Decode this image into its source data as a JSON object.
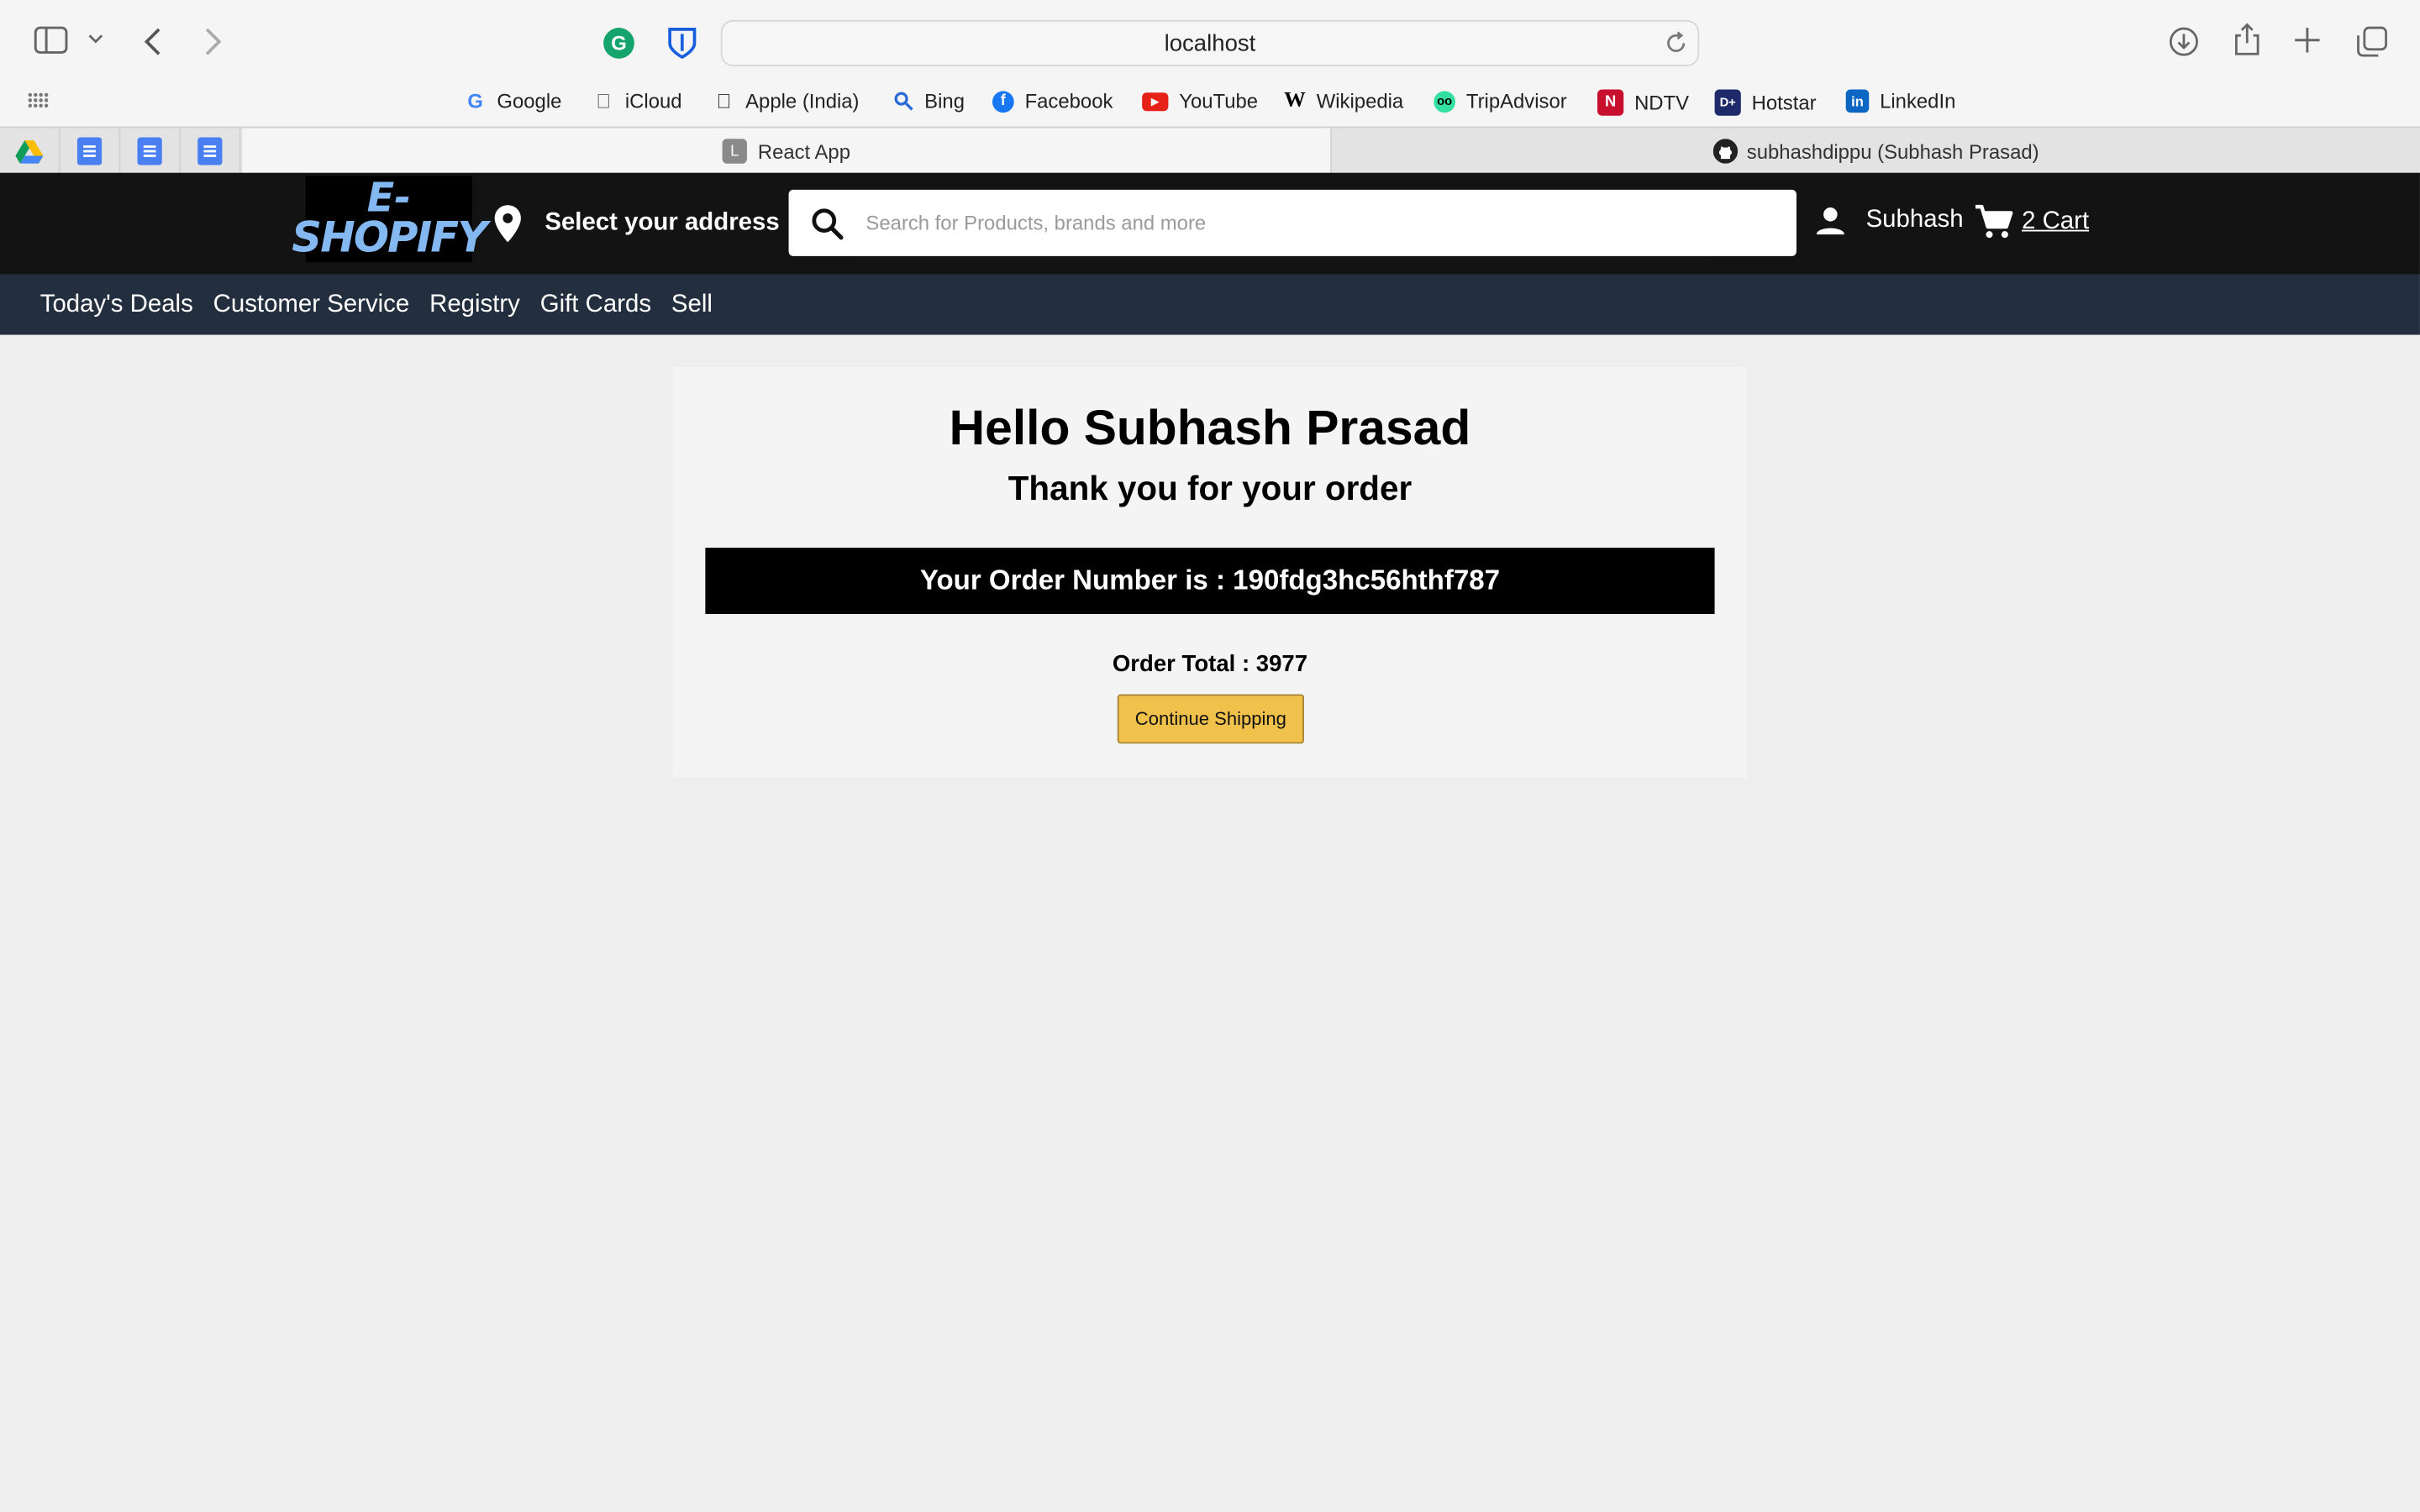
{
  "browser": {
    "url": "localhost",
    "favorites": [
      {
        "label": "Google",
        "icon": "google-icon",
        "color": "#4285f4"
      },
      {
        "label": "iCloud",
        "icon": "apple-icon",
        "color": "#555555"
      },
      {
        "label": "Apple (India)",
        "icon": "apple-icon",
        "color": "#222222"
      },
      {
        "label": "Bing",
        "icon": "search-icon",
        "color": "#2b6bd8"
      },
      {
        "label": "Facebook",
        "icon": "facebook-icon",
        "color": "#1877f2"
      },
      {
        "label": "YouTube",
        "icon": "youtube-icon",
        "color": "#e62117"
      },
      {
        "label": "Wikipedia",
        "icon": "wikipedia-icon",
        "color": "#000000"
      },
      {
        "label": "TripAdvisor",
        "icon": "tripadvisor-icon",
        "color": "#34e0a1"
      },
      {
        "label": "NDTV",
        "icon": "ndtv-icon",
        "color": "#c8102e"
      },
      {
        "label": "Hotstar",
        "icon": "hotstar-icon",
        "color": "#1f2a6b"
      },
      {
        "label": "LinkedIn",
        "icon": "linkedin-icon",
        "color": "#0a66c2"
      }
    ],
    "tabs": [
      {
        "label": "React App",
        "favicon": "L",
        "active": false
      },
      {
        "label": "subhashdippu (Subhash Prasad)",
        "favicon": "github-icon",
        "active": true
      }
    ]
  },
  "header": {
    "logo_line1": "E-",
    "logo_line2": "SHOPIFY",
    "address_label": "Select your address",
    "search_placeholder": "Search for Products, brands and more",
    "user_name": "Subhash",
    "cart_label": "2 Cart"
  },
  "subnav": {
    "items": [
      "Today's Deals",
      "Customer Service",
      "Registry",
      "Gift Cards",
      "Sell"
    ]
  },
  "order": {
    "greeting": "Hello Subhash Prasad",
    "thanks": "Thank you for your order",
    "order_number_text": "Your Order Number is : 190fdg3hc56hthf787",
    "order_total_text": "Order Total : 3977",
    "continue_label": "Continue Shipping"
  },
  "colors": {
    "header_bg": "#131313",
    "subnav_bg": "#232f3e",
    "button_bg": "#f0c14b",
    "logo_text": "#84b8f1"
  }
}
